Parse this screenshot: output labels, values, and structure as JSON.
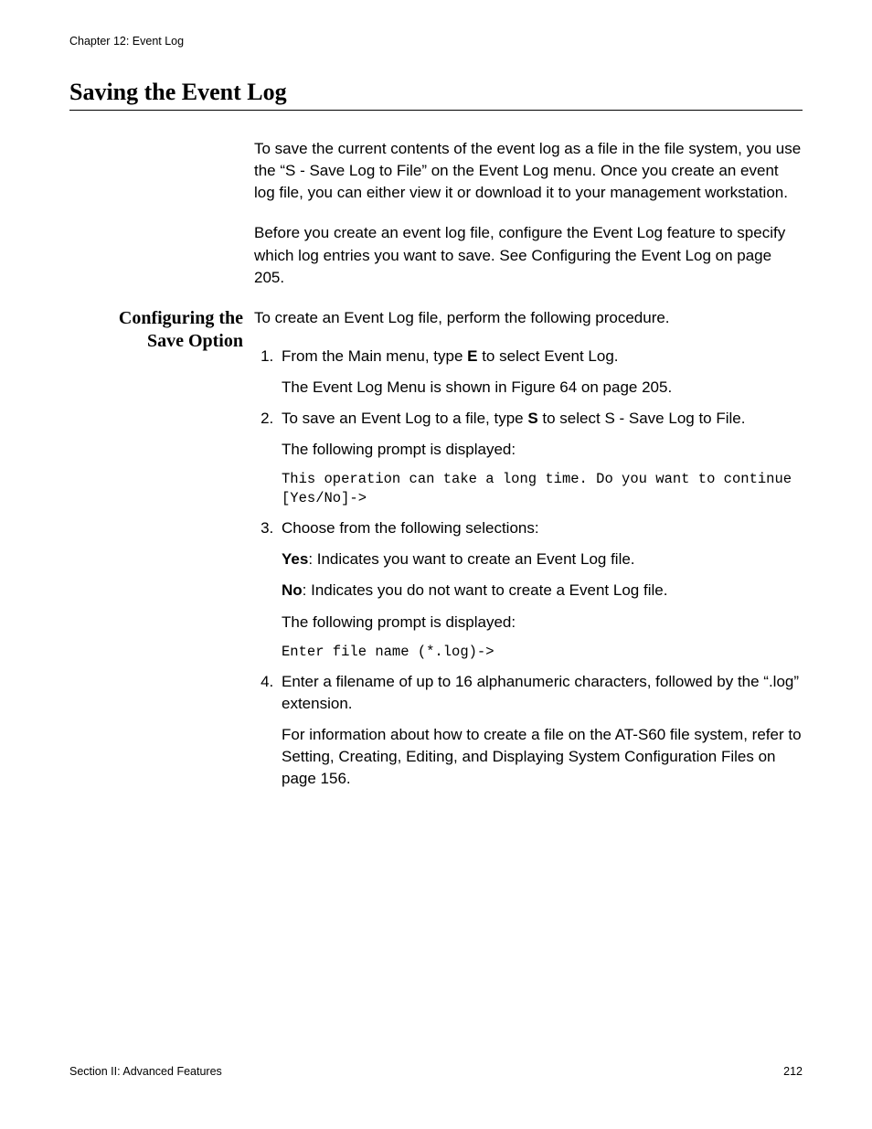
{
  "header": {
    "running": "Chapter 12: Event Log"
  },
  "title": "Saving the Event Log",
  "intro": {
    "p1": "To save the current contents of the event log as a file in the file system, you use the “S - Save Log to File” on the Event Log menu. Once you create an event log file, you can either view it or download it to your management workstation.",
    "p2": "Before you create an event log file, configure the Event Log feature to specify which log entries you want to save. See Configuring the Event Log on page 205."
  },
  "sidebar": {
    "line1": "Configuring the",
    "line2": "Save Option"
  },
  "procedure": {
    "lead": "To create an Event Log file, perform the following procedure.",
    "step1": {
      "pre": "From the Main menu, type ",
      "key": "E",
      "post": " to select Event Log.",
      "sub": "The Event Log Menu is shown in Figure 64 on page 205."
    },
    "step2": {
      "pre": "To save an Event Log to a file, type ",
      "key": "S",
      "post": " to select S - Save Log to File.",
      "sub": "The following prompt is displayed:",
      "code": "This operation can take a long time. Do you want to continue [Yes/No]->"
    },
    "step3": {
      "lead": "Choose from the following selections:",
      "yes_label": "Yes",
      "yes_text": ": Indicates you want to create an Event Log file.",
      "no_label": "No",
      "no_text": ": Indicates you do not want to create a Event Log file.",
      "sub": "The following prompt is displayed:",
      "code": "Enter file name (*.log)->"
    },
    "step4": {
      "text": "Enter a filename of up to 16 alphanumeric characters, followed by the “.log” extension.",
      "sub": "For information about how to create a file on the AT-S60 file system, refer to Setting, Creating, Editing, and Displaying System Configuration Files on page 156."
    }
  },
  "footer": {
    "left": "Section II: Advanced Features",
    "right": "212"
  }
}
